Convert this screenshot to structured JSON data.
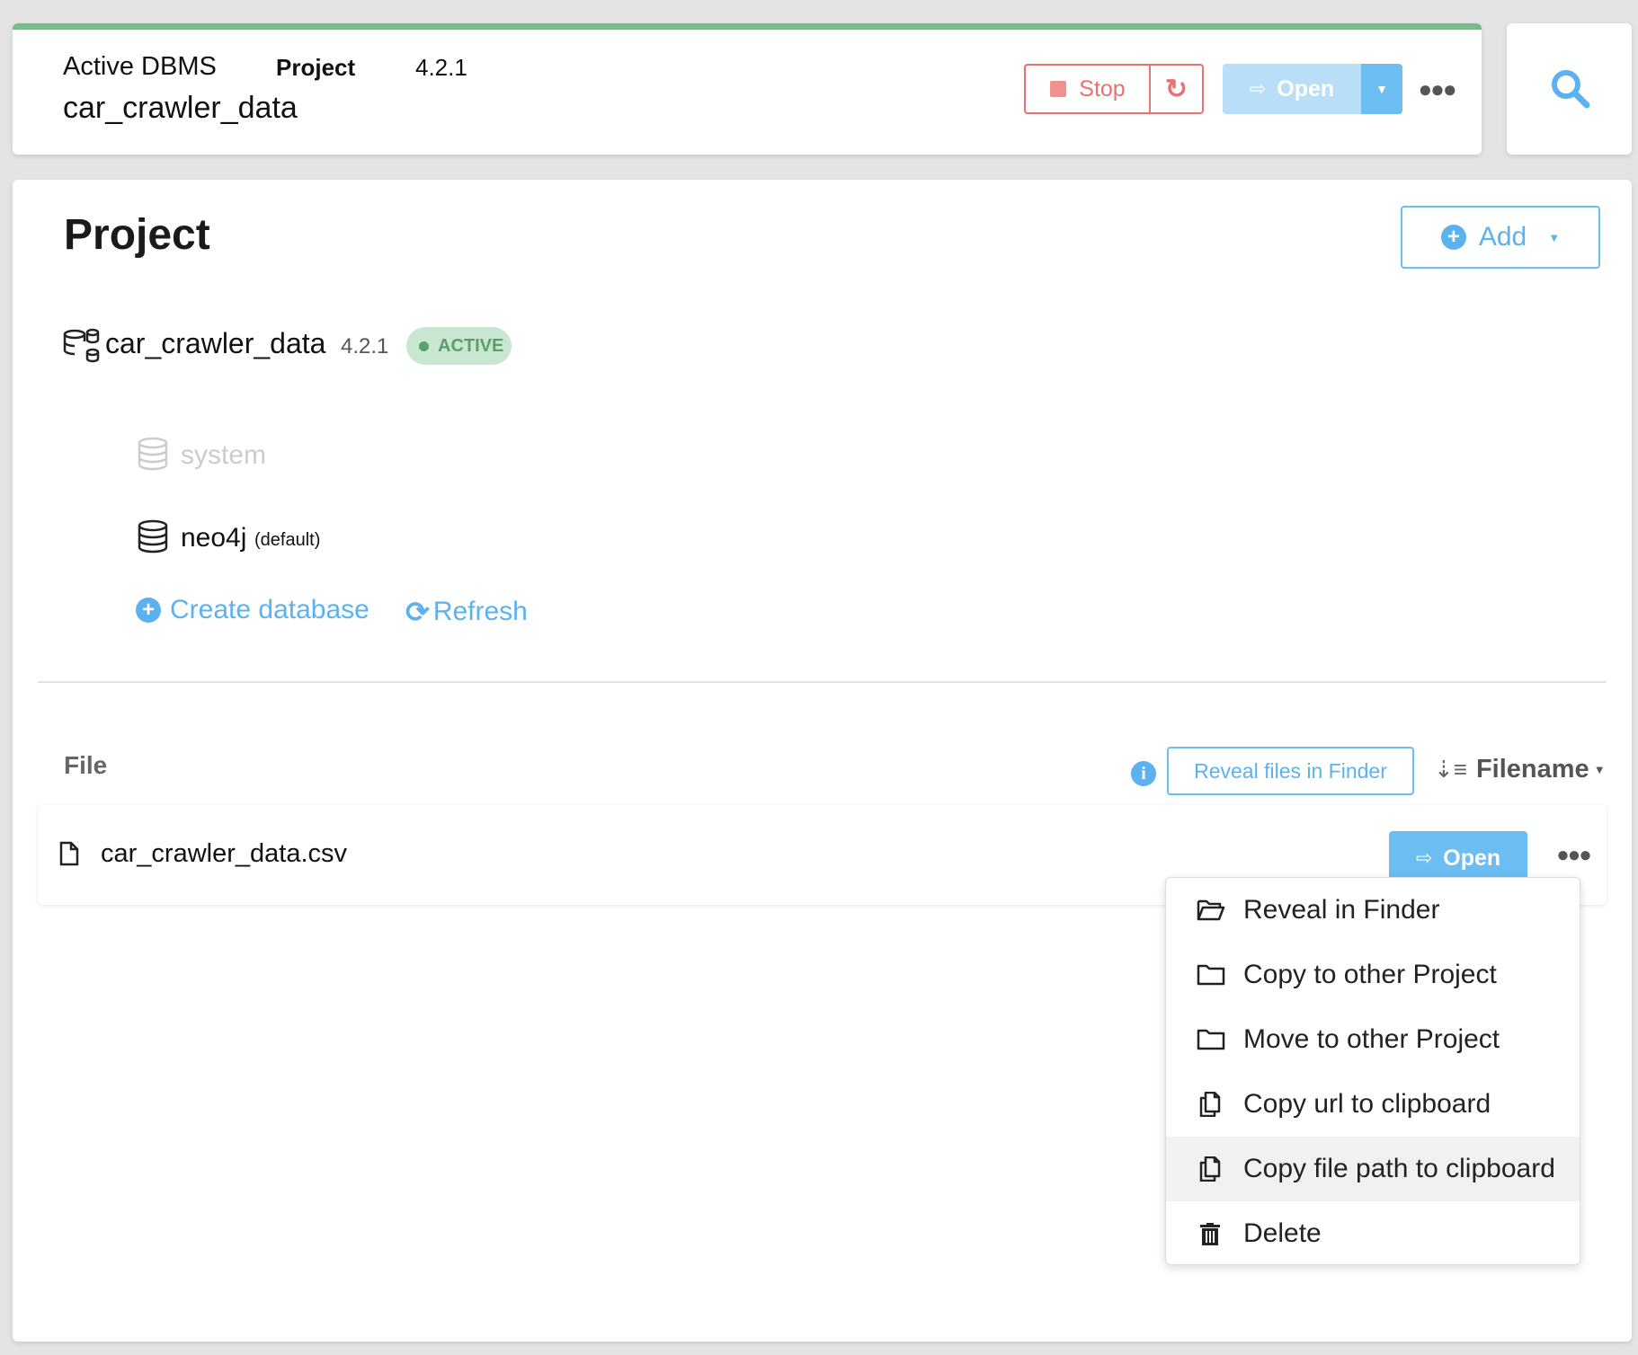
{
  "header": {
    "label_active_dbms": "Active DBMS",
    "label_project": "Project",
    "version": "4.2.1",
    "dbms_name": "car_crawler_data",
    "stop_label": "Stop",
    "open_label": "Open",
    "status_color": "#7bb78f"
  },
  "project": {
    "title": "Project",
    "add_label": "Add",
    "dbms": {
      "name": "car_crawler_data",
      "version": "4.2.1",
      "status": "ACTIVE"
    },
    "databases": [
      {
        "name": "system",
        "note": ""
      },
      {
        "name": "neo4j",
        "note": "(default)"
      }
    ],
    "create_database_label": "Create database",
    "refresh_label": "Refresh"
  },
  "files": {
    "section_label": "File",
    "reveal_label": "Reveal files in Finder",
    "sort_label": "Filename",
    "items": [
      {
        "name": "car_crawler_data.csv",
        "open_label": "Open"
      }
    ]
  },
  "context_menu": {
    "items": [
      {
        "label": "Reveal in Finder",
        "icon": "folder-open-icon"
      },
      {
        "label": "Copy to other Project",
        "icon": "folder-icon"
      },
      {
        "label": "Move to other Project",
        "icon": "folder-icon"
      },
      {
        "label": "Copy url to clipboard",
        "icon": "copy-icon"
      },
      {
        "label": "Copy file path to clipboard",
        "icon": "copy-icon",
        "highlighted": true
      },
      {
        "label": "Delete",
        "icon": "trash-icon"
      }
    ]
  },
  "colors": {
    "accent": "#5cb1ef",
    "danger": "#e77371",
    "active_badge_bg": "#c9e6d1",
    "active_badge_text": "#5aa06f"
  }
}
